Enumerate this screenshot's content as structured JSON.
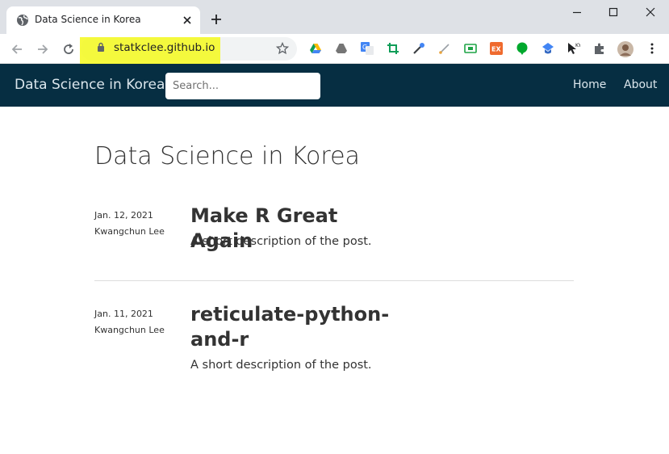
{
  "browser": {
    "tab_title": "Data Science in Korea",
    "url": "statkclee.github.io"
  },
  "site": {
    "brand": "Data Science in Korea",
    "search_placeholder": "Search...",
    "nav": [
      {
        "label": "Home"
      },
      {
        "label": "About"
      }
    ]
  },
  "main": {
    "title": "Data Science in Korea",
    "posts": [
      {
        "date": "Jan. 12, 2021",
        "author": "Kwangchun Lee",
        "title": "Make R Great Again",
        "description": "A short description of the post."
      },
      {
        "date": "Jan. 11, 2021",
        "author": "Kwangchun Lee",
        "title": "reticulate-python-and-r",
        "description": "A short description of the post."
      }
    ]
  },
  "colors": {
    "navbar": "#062e42",
    "highlight": "#f4f91c",
    "text": "#333333"
  },
  "icons": [
    "globe-icon",
    "close-icon",
    "plus-icon",
    "minimize-icon",
    "maximize-icon",
    "window-close-icon",
    "back-arrow-icon",
    "forward-arrow-icon",
    "reload-icon",
    "lock-icon",
    "star-icon",
    "google-drive-icon",
    "drive-gray-icon",
    "translate-icon",
    "crop-icon",
    "eyedropper-icon",
    "brush-icon",
    "screen-icon",
    "ex-icon",
    "evernote-icon",
    "scholar-icon",
    "cursor-icon",
    "puzzle-icon",
    "avatar",
    "kebab-menu-icon"
  ]
}
